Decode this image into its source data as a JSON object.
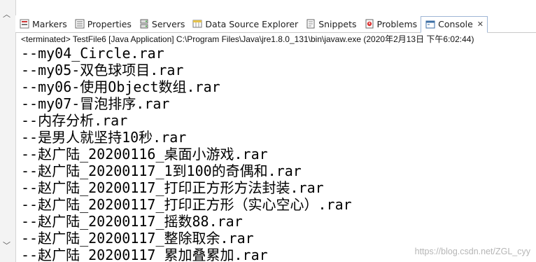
{
  "tabs": [
    {
      "id": "markers",
      "label": "Markers",
      "icon": "markers-icon"
    },
    {
      "id": "properties",
      "label": "Properties",
      "icon": "properties-icon"
    },
    {
      "id": "servers",
      "label": "Servers",
      "icon": "servers-icon"
    },
    {
      "id": "datasource",
      "label": "Data Source Explorer",
      "icon": "data-source-icon"
    },
    {
      "id": "snippets",
      "label": "Snippets",
      "icon": "snippets-icon"
    },
    {
      "id": "problems",
      "label": "Problems",
      "icon": "problems-icon"
    },
    {
      "id": "console",
      "label": "Console",
      "icon": "console-icon",
      "active": true,
      "close": "✕"
    }
  ],
  "console": {
    "status": "<terminated> TestFile6 [Java Application] C:\\Program Files\\Java\\jre1.8.0_131\\bin\\javaw.exe (2020年2月13日 下午6:02:44)",
    "lines": [
      "--my04_Circle.rar",
      "--my05-双色球项目.rar",
      "--my06-使用Object数组.rar",
      "--my07-冒泡排序.rar",
      "--内存分析.rar",
      "--是男人就坚持10秒.rar",
      "--赵广陆_20200116_桌面小游戏.rar",
      "--赵广陆_20200117_1到100的奇偶和.rar",
      "--赵广陆_20200117_打印正方形方法封装.rar",
      "--赵广陆_20200117_打印正方形（实心空心）.rar",
      "--赵广陆_20200117_摇数88.rar",
      "--赵广陆_20200117_整除取余.rar",
      "--赵广陆_20200117_累加叠累加.rar"
    ]
  },
  "watermark": "https://blog.csdn.net/ZGL_cyy",
  "colors": {
    "active_tab_border": "#9fb6d6",
    "tab_bar_border": "#c9c9c9",
    "text": "#000000"
  }
}
